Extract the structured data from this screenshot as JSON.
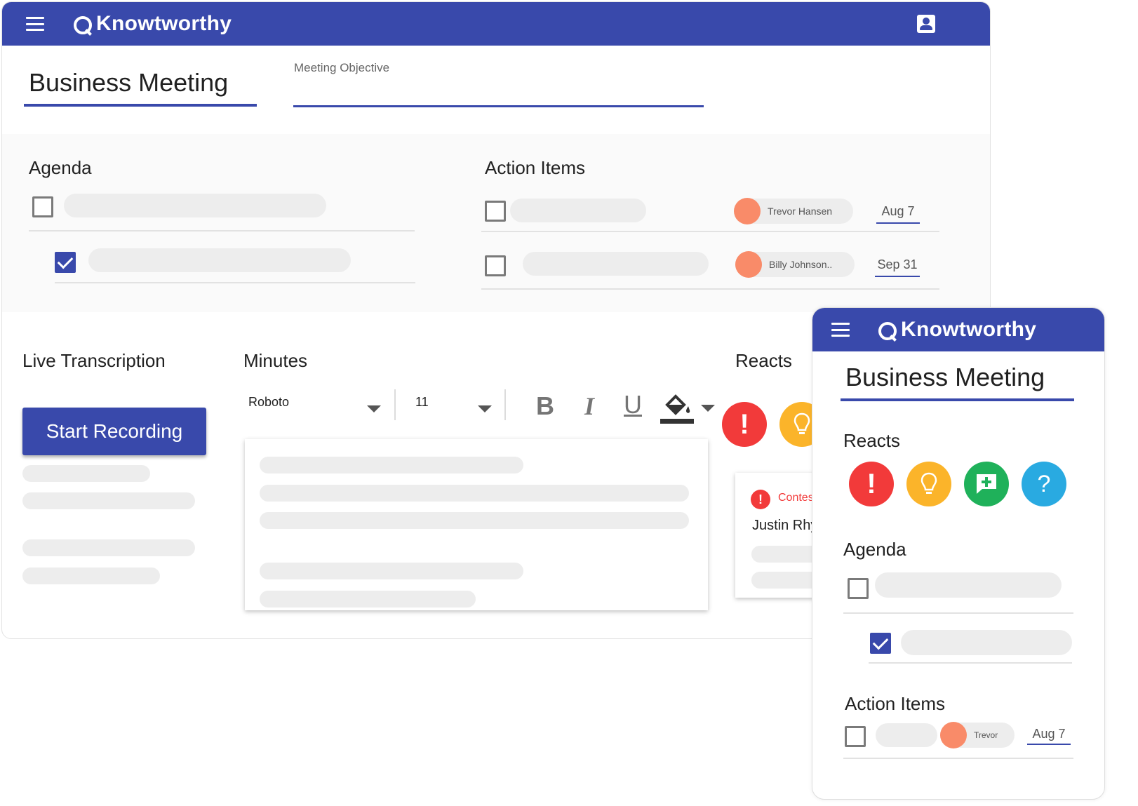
{
  "brand": {
    "name": "Knowtworthy",
    "primary_color": "#3949ab",
    "avatar_color": "#f98b69"
  },
  "desktop": {
    "header": {
      "menu_icon": "menu-icon",
      "account_icon": "account-icon"
    },
    "meeting_title": "Business Meeting",
    "objective_label": "Meeting Objective",
    "agenda": {
      "title": "Agenda",
      "items": [
        {
          "checked": false
        },
        {
          "checked": true
        }
      ]
    },
    "action_items": {
      "title": "Action Items",
      "items": [
        {
          "checked": false,
          "assignee": "Trevor Hansen",
          "date": "Aug 7"
        },
        {
          "checked": false,
          "assignee": "Billy Johnson..",
          "date": "Sep 31"
        }
      ]
    },
    "live_transcription": {
      "title": "Live Transcription",
      "button_label": "Start Recording"
    },
    "minutes": {
      "title": "Minutes",
      "font_family": "Roboto",
      "font_size": "11",
      "format_buttons": {
        "bold": "B",
        "italic": "I",
        "underline": "U"
      }
    },
    "reacts": {
      "title": "Reacts",
      "card": {
        "tag": "Contes",
        "author": "Justin Rhy"
      }
    }
  },
  "mobile": {
    "meeting_title": "Business Meeting",
    "reacts_title": "Reacts",
    "reacts": [
      {
        "icon": "exclamation-icon",
        "glyph": "!",
        "color": "#f23a3a"
      },
      {
        "icon": "lightbulb-icon",
        "glyph": "",
        "color": "#fbb42a"
      },
      {
        "icon": "add-comment-icon",
        "glyph": "+",
        "color": "#1fb15a"
      },
      {
        "icon": "question-icon",
        "glyph": "?",
        "color": "#29aae1"
      }
    ],
    "agenda_title": "Agenda",
    "action_items_title": "Action Items",
    "action_item": {
      "assignee": "Trevor",
      "date": "Aug 7"
    }
  }
}
